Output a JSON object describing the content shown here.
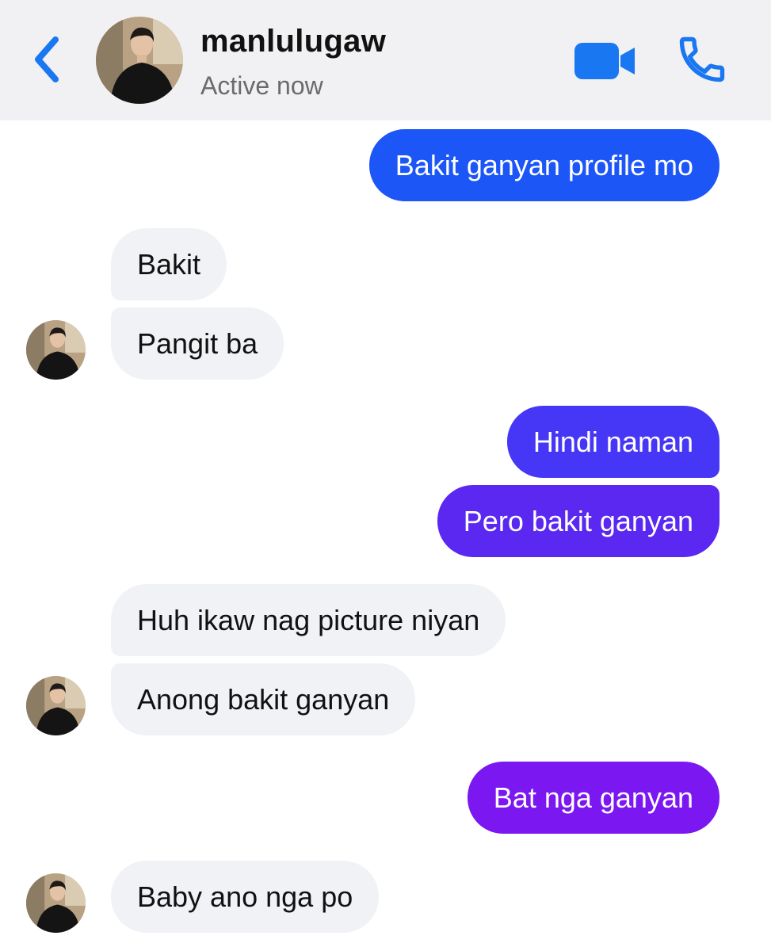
{
  "header": {
    "contact_name": "manlulugaw",
    "status": "Active now",
    "back_icon": "chevron-left-icon",
    "video_icon": "video-camera-icon",
    "call_icon": "phone-icon",
    "accent_color": "#1977f2"
  },
  "messages": [
    {
      "sender": "me",
      "text": "Bakit ganyan profile mo",
      "color": "#1c56f7"
    },
    {
      "sender": "contact",
      "text": "Bakit"
    },
    {
      "sender": "contact",
      "text": "Pangit ba"
    },
    {
      "sender": "me",
      "text": "Hindi naman",
      "color": "#4636f5"
    },
    {
      "sender": "me",
      "text": "Pero bakit ganyan",
      "color": "#5a28f1"
    },
    {
      "sender": "contact",
      "text": "Huh ikaw nag picture niyan"
    },
    {
      "sender": "contact",
      "text": "Anong bakit ganyan"
    },
    {
      "sender": "me",
      "text": "Bat nga ganyan",
      "color": "#7b17f1"
    },
    {
      "sender": "contact",
      "text": "Baby ano nga po"
    }
  ]
}
